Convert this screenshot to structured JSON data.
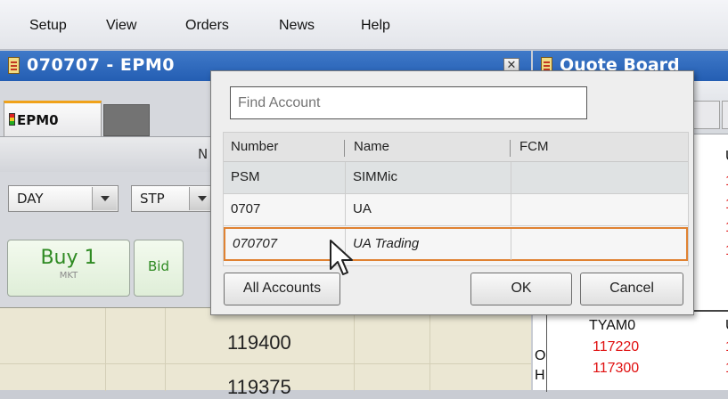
{
  "menu": [
    "Setup",
    "View",
    "Orders",
    "News",
    "Help"
  ],
  "order_window": {
    "title": "070707 - EPM0",
    "tab_label": "EPM0",
    "strip_partial": "N",
    "tif_value": "DAY",
    "type_value": "STP",
    "buy_label": "Buy 1",
    "buy_sub": "MKT",
    "bid_label": "Bid",
    "ladder_prices": [
      "119400",
      "119375"
    ]
  },
  "quote_board": {
    "title": "Quote Board",
    "partial_letters": [
      "U",
      "U"
    ],
    "values_top": [
      "1",
      "1",
      "1",
      "1"
    ],
    "symbol": "TYAM0",
    "row_letters": [
      "O",
      "H"
    ],
    "values_bottom": [
      "117220",
      "117300"
    ],
    "values_bottom_right": [
      "1",
      "1"
    ]
  },
  "account_dialog": {
    "find_placeholder": "Find Account",
    "columns": [
      "Number",
      "Name",
      "FCM"
    ],
    "rows": [
      {
        "number": "PSM",
        "name": "SIMMic",
        "fcm": ""
      },
      {
        "number": "0707",
        "name": "UA",
        "fcm": ""
      },
      {
        "number": "070707",
        "name": "UA Trading",
        "fcm": "",
        "selected": true
      }
    ],
    "all_accounts_label": "All Accounts",
    "ok_label": "OK",
    "cancel_label": "Cancel"
  },
  "colors": {
    "title_blue": "#245eb3",
    "price_red": "#e01010",
    "buy_green": "#2e8a22",
    "selection_orange": "#e08232"
  }
}
